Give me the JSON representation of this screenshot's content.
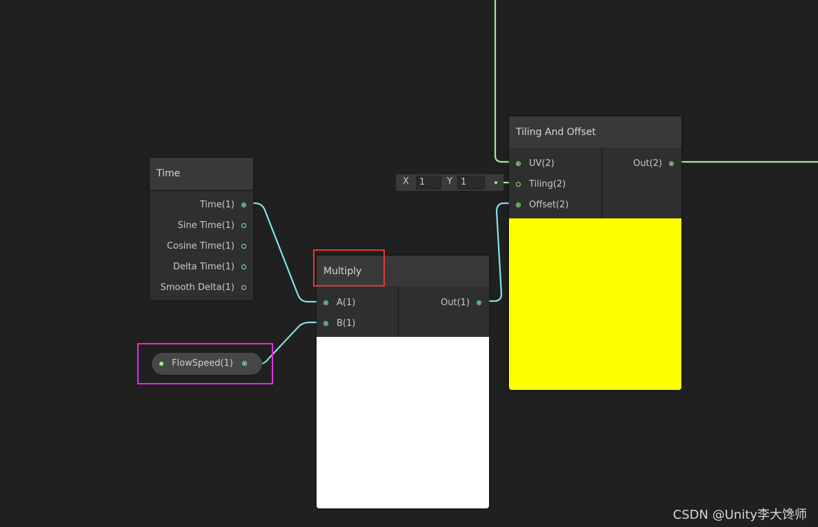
{
  "colors": {
    "canvas": "#202020",
    "float_wire": "#84e4e7",
    "vector2_wire": "#9ff08f",
    "multiply_preview": "#ffffff",
    "tiling_preview": "#ffff00",
    "highlight_red": "#e33b3b",
    "highlight_magenta": "#e62ce6"
  },
  "time_node": {
    "title": "Time",
    "outputs": [
      "Time(1)",
      "Sine Time(1)",
      "Cosine Time(1)",
      "Delta Time(1)",
      "Smooth Delta(1)"
    ]
  },
  "flowspeed_property": {
    "label": "FlowSpeed(1)"
  },
  "multiply_node": {
    "title": "Multiply",
    "inputs": [
      "A(1)",
      "B(1)"
    ],
    "output": "Out(1)"
  },
  "tiling_node": {
    "title": "Tiling And Offset",
    "inputs": [
      "UV(2)",
      "Tiling(2)",
      "Offset(2)"
    ],
    "output": "Out(2)",
    "tiling_default": {
      "x_label": "X",
      "x_value": "1",
      "y_label": "Y",
      "y_value": "1"
    }
  },
  "watermark": "CSDN @Unity李大馋师"
}
